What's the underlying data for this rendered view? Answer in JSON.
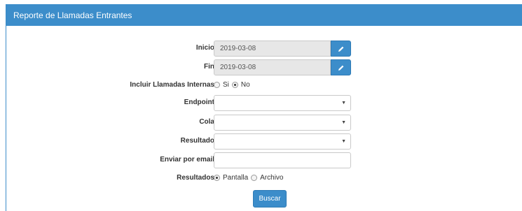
{
  "panel": {
    "title": "Reporte de Llamadas Entrantes"
  },
  "form": {
    "inicio": {
      "label": "Inicio",
      "value": "2019-03-08",
      "edit_icon": "pencil-icon"
    },
    "fin": {
      "label": "Fin",
      "value": "2019-03-08",
      "edit_icon": "pencil-icon"
    },
    "incluir": {
      "label": "Incluir Llamadas Internas",
      "options": [
        "Si",
        "No"
      ],
      "selected": "No"
    },
    "endpoint": {
      "label": "Endpoint",
      "value": ""
    },
    "cola": {
      "label": "Cola",
      "value": ""
    },
    "resultado": {
      "label": "Resultado",
      "value": ""
    },
    "email": {
      "label": "Enviar por email",
      "value": ""
    },
    "resultados": {
      "label": "Resultados",
      "options": [
        "Pantalla",
        "Archivo"
      ],
      "selected": "Pantalla"
    },
    "buscar_label": "Buscar"
  },
  "colors": {
    "primary": "#3c8dca",
    "readonly_bg": "#e7e7e7"
  }
}
